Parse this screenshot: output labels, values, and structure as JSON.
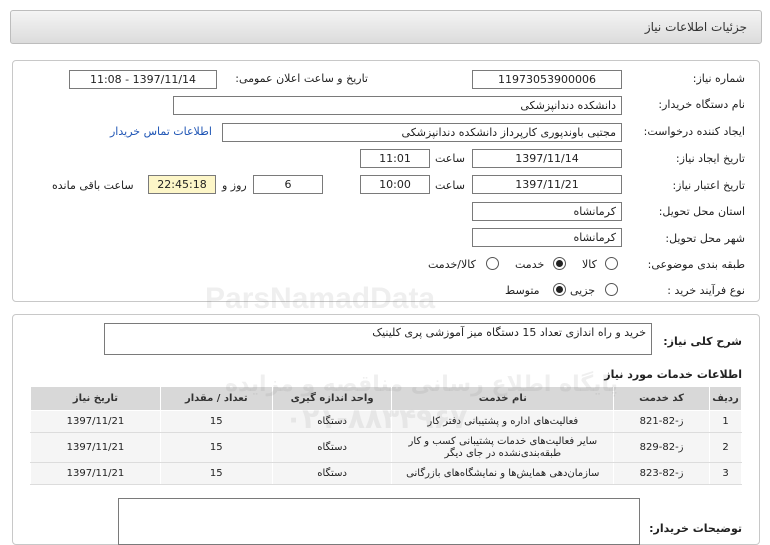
{
  "window": {
    "title": "جزئیات اطلاعات نیاز"
  },
  "form": {
    "need_number_label": "شماره نیاز:",
    "need_number": "11973053900006",
    "announce_label": "تاریخ و ساعت اعلان عمومی:",
    "announce_value": "1397/11/14 - 11:08",
    "buyer_org_label": "نام دستگاه خریدار:",
    "buyer_org": "دانشکده دندانپزشکی",
    "requester_label": "ایجاد کننده درخواست:",
    "requester": "مجتبی  باوندپوری کارپرداز دانشکده دندانپزشکی",
    "contact_link": "اطلاعات تماس خریدار",
    "created_label": "تاریخ ایجاد نیاز:",
    "created_date": "1397/11/14",
    "time_label": "ساعت",
    "created_time": "11:01",
    "valid_label": "تاریخ اعتبار نیاز:",
    "valid_date": "1397/11/21",
    "valid_time": "10:00",
    "days_value": "6",
    "days_label": "روز و",
    "remaining_time": "22:45:18",
    "remaining_label": "ساعت باقی مانده",
    "province_label": "استان محل تحویل:",
    "province": "کرمانشاه",
    "city_label": "شهر محل تحویل:",
    "city": "کرمانشاه",
    "category_label": "طبقه بندی موضوعی:",
    "category_options": [
      "کالا",
      "خدمت",
      "کالا/خدمت"
    ],
    "category_selected": "خدمت",
    "process_label": "نوع فرآیند خرید :",
    "process_options": [
      "جزیی",
      "متوسط"
    ],
    "process_selected": "متوسط"
  },
  "summary": {
    "label": "شرح کلی نیاز:",
    "text": "خرید و راه اندازی تعداد 15 دستگاه میز آموزشی پری کلینیک"
  },
  "services": {
    "title": "اطلاعات خدمات مورد نیاز",
    "headers": [
      "ردیف",
      "کد خدمت",
      "نام خدمت",
      "واحد اندازه گیری",
      "تعداد / مقدار",
      "تاریخ نیاز"
    ],
    "rows": [
      {
        "row": "1",
        "code": "ز-82-821",
        "name": "فعالیت‌های اداره و پشتیبانی دفتر کار",
        "unit": "دستگاه",
        "qty": "15",
        "date": "1397/11/21"
      },
      {
        "row": "2",
        "code": "ز-82-829",
        "name": "سایر فعالیت‌های خدمات پشتیبانی کسب و کار طبقه‌بندی‌نشده در جای دیگر",
        "unit": "دستگاه",
        "qty": "15",
        "date": "1397/11/21"
      },
      {
        "row": "3",
        "code": "ز-82-823",
        "name": "سازمان‌دهی همایش‌ها و نمایشگاه‌های بازرگانی",
        "unit": "دستگاه",
        "qty": "15",
        "date": "1397/11/21"
      }
    ]
  },
  "buyer_notes": {
    "label": "توضیحات خریدار:",
    "text": ""
  },
  "watermark": {
    "brand": "ParsNamadData",
    "line1": "پایگاه اطلاع رسانی مناقصه و مزایده",
    "phone": "۰۲۱-۸۸۳۴۹۶۷۰"
  }
}
